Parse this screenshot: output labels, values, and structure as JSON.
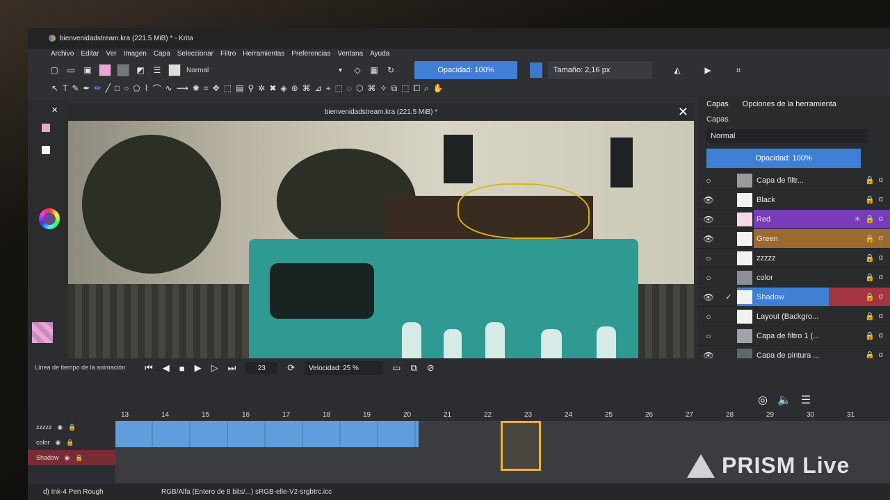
{
  "window": {
    "title": "bienvenidadstream.kra (221.5 MiB) * - Krita",
    "controls": [
      "—",
      "▢",
      "✕"
    ]
  },
  "menu": [
    "Archivo",
    "Editar",
    "Ver",
    "Imagen",
    "Capa",
    "Seleccionar",
    "Filtro",
    "Herramientas",
    "Preferencias",
    "Ventana",
    "Ayuda"
  ],
  "toolbar": {
    "blend_mode": "Normal",
    "opacity_label": "Opacidad: 100%",
    "size_label": "Tamaño: 2,16 px"
  },
  "document": {
    "tab_title": "bienvenidadstream.kra (221.5 MiB) *"
  },
  "colors": {
    "accent": "#3f7fd6",
    "playhead": "#f0b428",
    "layer_red": "#7a3bb8",
    "layer_green": "#9a6a2e"
  },
  "layers_panel": {
    "tabs": [
      "Capas",
      "Opciones de la herramienta"
    ],
    "title": "Capas",
    "blend_mode": "Normal",
    "opacity_label": "Opacidad: 100%",
    "layers": [
      {
        "name": "Capa de filtr...",
        "visible": false
      },
      {
        "name": "Black",
        "visible": true
      },
      {
        "name": "Red",
        "visible": true
      },
      {
        "name": "Green",
        "visible": true
      },
      {
        "name": "zzzzz",
        "visible": false
      },
      {
        "name": "color",
        "visible": false
      },
      {
        "name": "Shadow",
        "visible": true
      },
      {
        "name": "Layout (Backgro...",
        "visible": false
      },
      {
        "name": "Capa de filtro 1 (...",
        "visible": false
      },
      {
        "name": "Capa de pintura ...",
        "visible": true
      }
    ]
  },
  "timeline": {
    "title": "Línea de tiempo de la animación",
    "current_frame": "23",
    "speed_label": "Velocidad: 25 %",
    "ruler": [
      "13",
      "14",
      "15",
      "16",
      "17",
      "18",
      "19",
      "20",
      "21",
      "22",
      "23",
      "24",
      "25",
      "26",
      "27",
      "28",
      "29",
      "30",
      "31"
    ],
    "tracks": [
      "zzzzz",
      "color",
      "Shadow"
    ]
  },
  "status": {
    "brush": "d) Ink-4 Pen Rough",
    "color_space": "RGB/Alfa (Entero de 8 bits/...)  sRGB-elle-V2-srgbtrc.icc"
  },
  "watermark": "PRISM Live"
}
